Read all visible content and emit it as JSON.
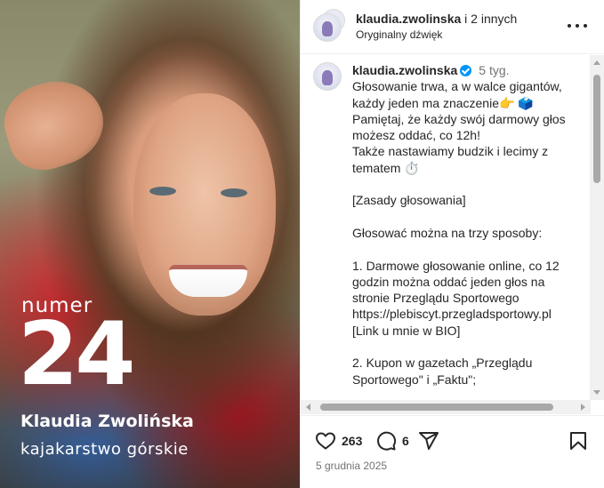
{
  "media": {
    "numer_label": "numer",
    "number": "24",
    "athlete_name": "Klaudia Zwolińska",
    "discipline": "kajakarstwo górskie"
  },
  "header": {
    "username": "klaudia.zwolinska",
    "collaborators": " i 2 innych",
    "audio": "Oryginalny dźwięk"
  },
  "comment": {
    "username": "klaudia.zwolinska",
    "time": "5 tyg.",
    "lines": [
      "Głosowanie trwa, a w walce gigantów,",
      "każdy jeden ma znaczenie👉 🗳️",
      "Pamiętaj, że każdy swój darmowy głos",
      "możesz oddać, co 12h!",
      "Także nastawiamy budzik i lecimy z",
      "tematem ⏱️",
      "",
      "[Zasady głosowania]",
      "",
      "Głosować można na trzy sposoby:",
      "",
      "1. Darmowe głosowanie online, co 12",
      "godzin można oddać jeden głos na",
      "stronie Przeglądu Sportowego",
      "https://plebiscyt.przegladsportowy.pl",
      "[Link u mnie w BIO]",
      "",
      "2. Kupon w gazetach „Przeglądu",
      "Sportowego\" i „Faktu\";"
    ]
  },
  "actions": {
    "likes": "263",
    "comments": "6",
    "date": "5 grudnia 2025"
  },
  "icons": {
    "like": "heart-icon",
    "comment": "comment-bubble-icon",
    "share": "paper-plane-icon",
    "save": "bookmark-icon",
    "more": "more-horizontal-icon",
    "verified": "verified-badge-icon"
  },
  "colors": {
    "verified": "#0095f6",
    "secondary_text": "#737373",
    "text": "#262626"
  }
}
